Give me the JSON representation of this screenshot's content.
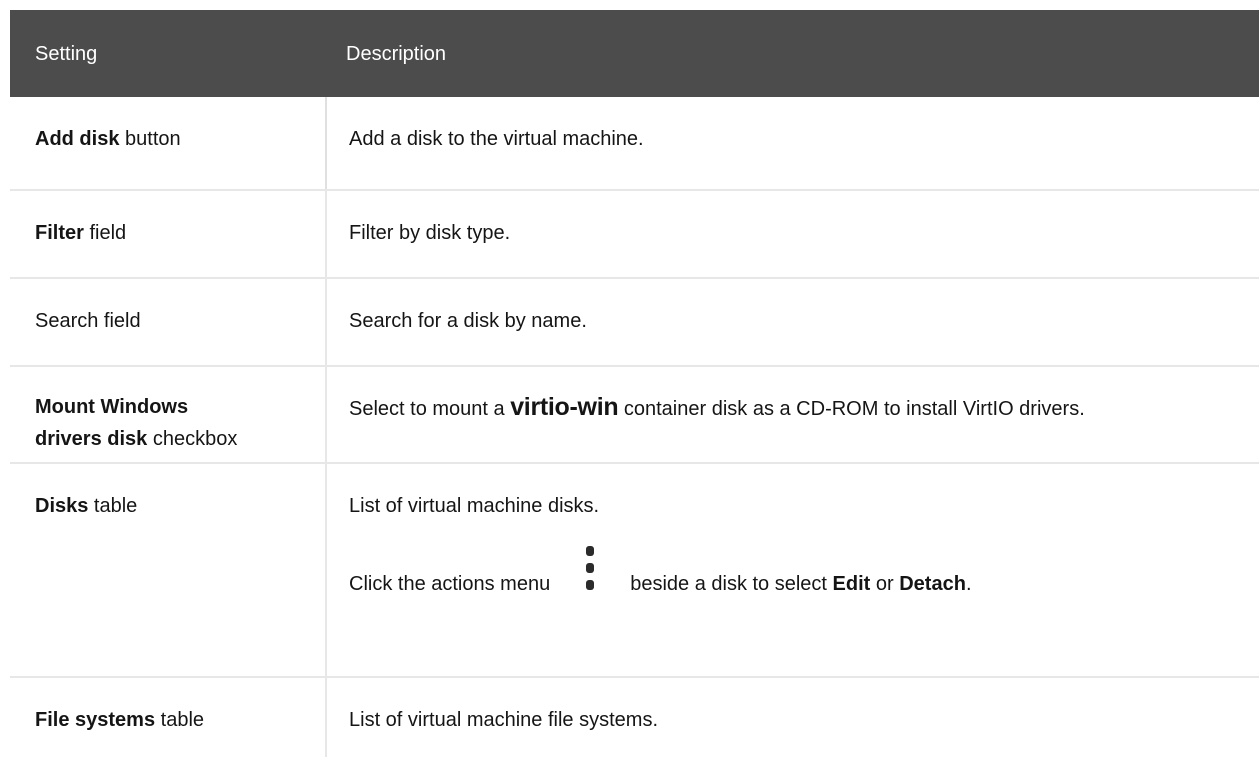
{
  "header": {
    "setting": "Setting",
    "description": "Description"
  },
  "rows": [
    {
      "setting_bold": "Add disk",
      "setting_suffix": " button",
      "description": "Add a disk to the virtual machine."
    },
    {
      "setting_bold": "Filter",
      "setting_suffix": " field",
      "description": "Filter by disk type."
    },
    {
      "setting_plain": "Search field",
      "description": "Search for a disk by name."
    },
    {
      "setting_bold_line1": "Mount Windows",
      "setting_bold_line2": "drivers disk",
      "setting_suffix": " checkbox",
      "description_prefix": "Select to mount a ",
      "description_code": "virtio-win",
      "description_suffix": " container disk as a CD-ROM to install VirtIO drivers."
    },
    {
      "setting_bold": "Disks",
      "setting_suffix": " table",
      "description": "List of virtual machine disks.",
      "actions_prefix": "Click the actions menu",
      "actions_middle": "beside a disk to select ",
      "actions_edit": "Edit",
      "actions_or": " or ",
      "actions_detach": "Detach",
      "actions_end": ".",
      "icon": "kebab-menu-icon"
    },
    {
      "setting_bold": "File systems",
      "setting_suffix": " table",
      "description": "List of virtual machine file systems."
    }
  ]
}
